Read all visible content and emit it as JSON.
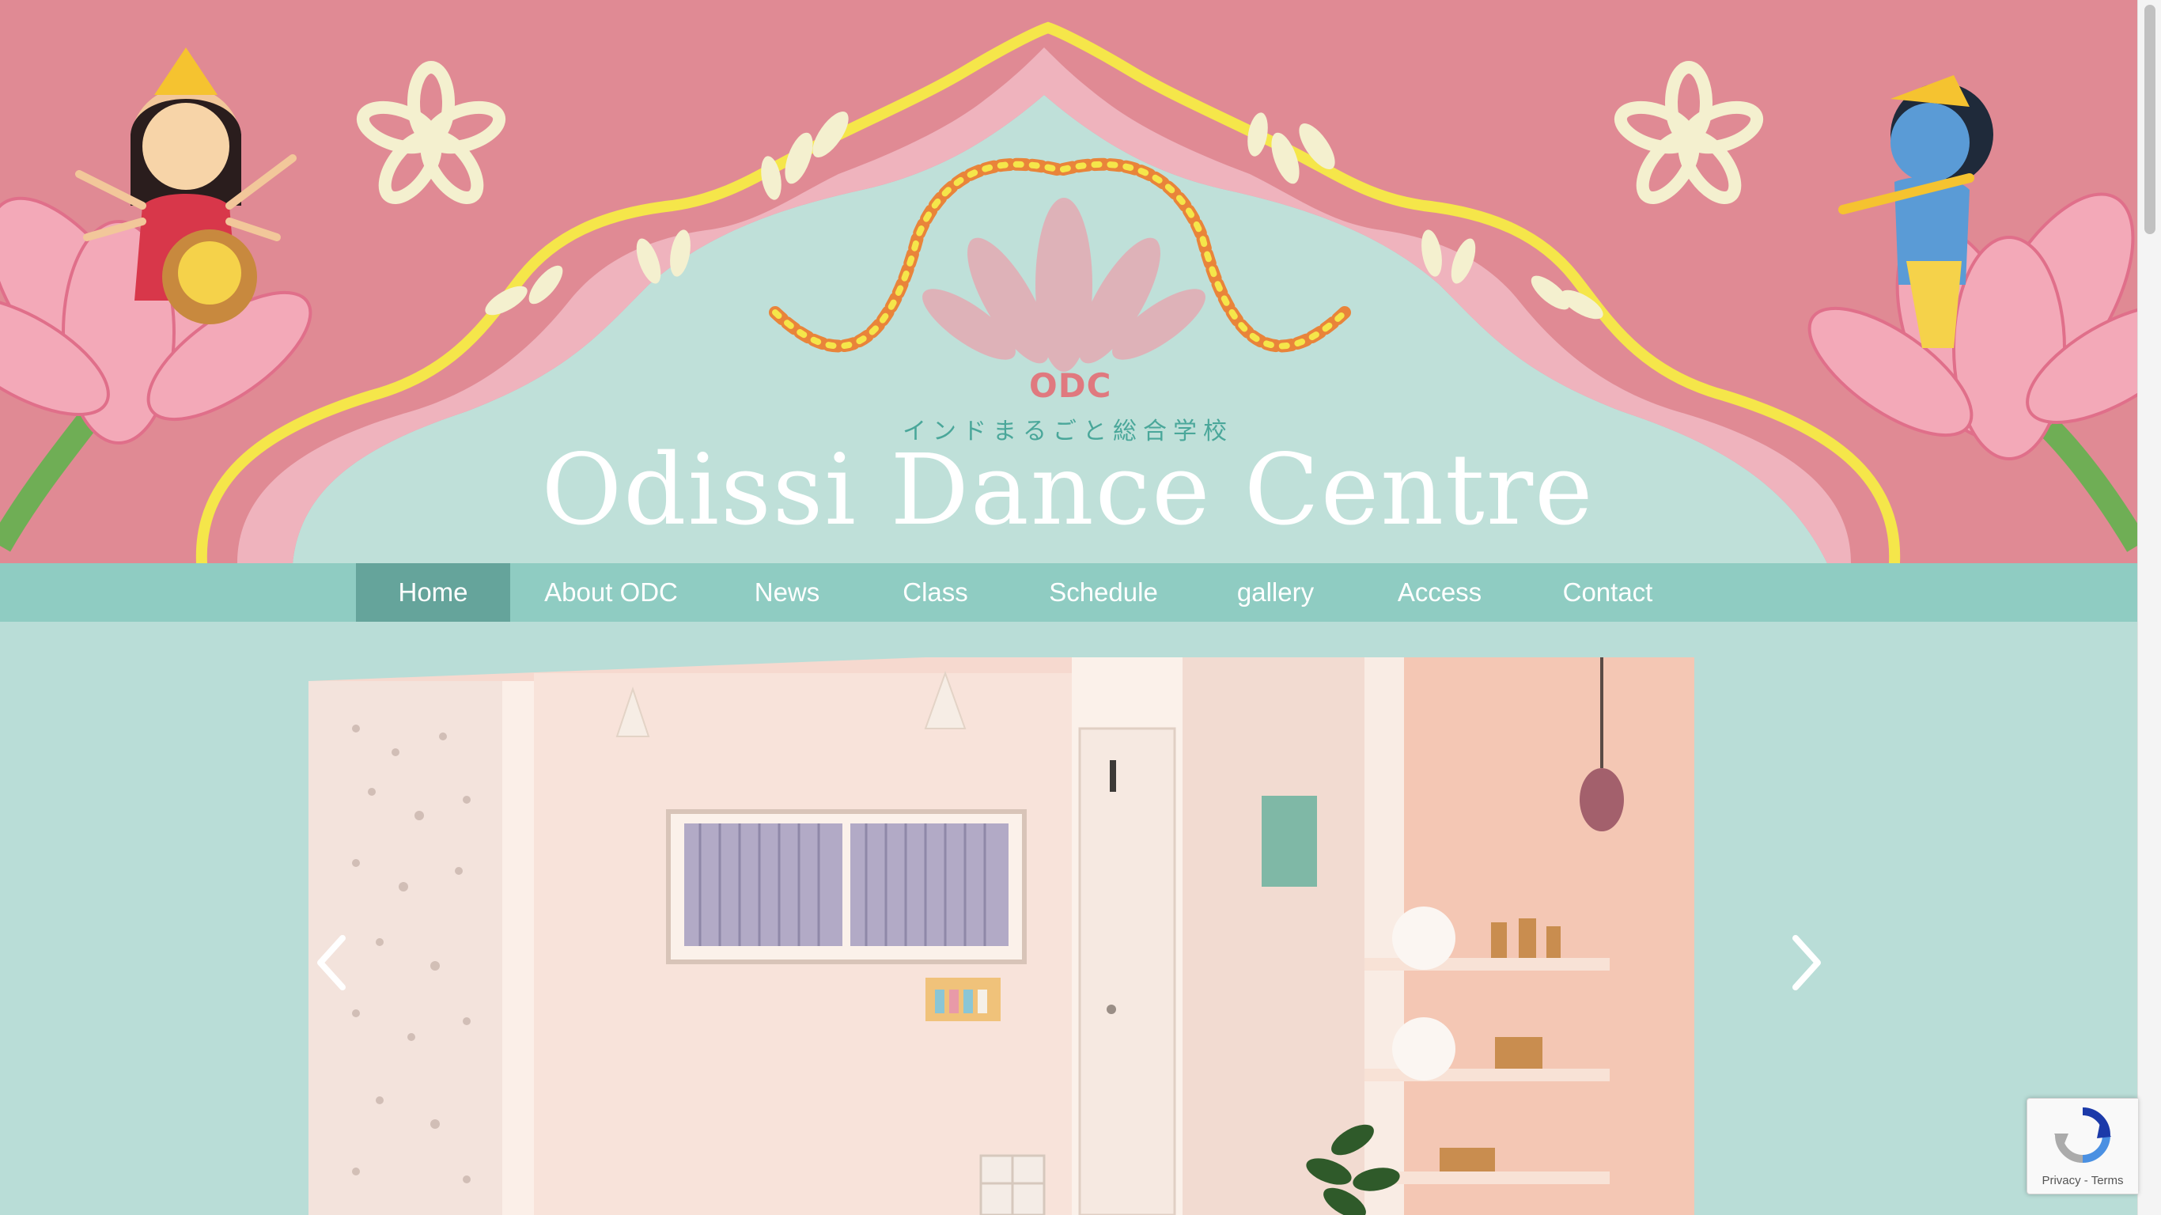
{
  "header": {
    "acronym": "ODC",
    "subtitle": "インドまるごと総合学校",
    "title": "Odissi Dance Centre"
  },
  "nav": {
    "active": "Home",
    "items": [
      {
        "label": "Home"
      },
      {
        "label": "About ODC"
      },
      {
        "label": "News"
      },
      {
        "label": "Class"
      },
      {
        "label": "Schedule"
      },
      {
        "label": "gallery"
      },
      {
        "label": "Access"
      },
      {
        "label": "Contact"
      }
    ]
  },
  "slider": {
    "prev_icon": "chevron-left-icon",
    "next_icon": "chevron-right-icon"
  },
  "recaptcha": {
    "privacy": "Privacy",
    "separator": "-",
    "terms": "Terms"
  },
  "colors": {
    "banner_pink": "#e08a94",
    "mint": "#b9ddd7",
    "nav_teal": "#8fccc2",
    "nav_active": "#65a49b",
    "arch_yellow": "#f5e64a"
  }
}
